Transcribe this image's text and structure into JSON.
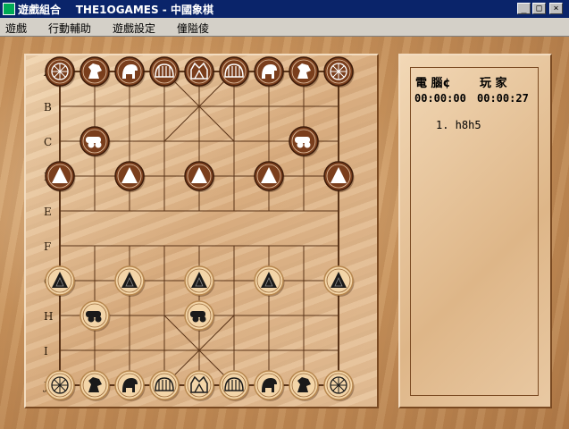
{
  "window": {
    "title": "遊戲組合    THE1OGAMES - 中國象棋",
    "btn_minimize": "_",
    "btn_maximize": "□",
    "btn_close": "×"
  },
  "menu": {
    "items": [
      "遊戲",
      "行動輔助",
      "遊戲設定",
      "僮隘倰"
    ]
  },
  "board": {
    "row_labels": [
      "A",
      "B",
      "C",
      "D",
      "E",
      "F",
      "G",
      "H",
      "I",
      "J"
    ],
    "colors": {
      "line": "#5a3418",
      "dark_piece": "#7a3e1c",
      "light_piece": "#f3d5a8",
      "label": "#2a1a0a"
    },
    "pieces": [
      {
        "side": "dark",
        "kind": "chariot",
        "col": 0,
        "row": 0
      },
      {
        "side": "dark",
        "kind": "horse",
        "col": 1,
        "row": 0
      },
      {
        "side": "dark",
        "kind": "elephant",
        "col": 2,
        "row": 0
      },
      {
        "side": "dark",
        "kind": "advisor",
        "col": 3,
        "row": 0
      },
      {
        "side": "dark",
        "kind": "general",
        "col": 4,
        "row": 0
      },
      {
        "side": "dark",
        "kind": "advisor",
        "col": 5,
        "row": 0
      },
      {
        "side": "dark",
        "kind": "elephant",
        "col": 6,
        "row": 0
      },
      {
        "side": "dark",
        "kind": "horse",
        "col": 7,
        "row": 0
      },
      {
        "side": "dark",
        "kind": "chariot",
        "col": 8,
        "row": 0
      },
      {
        "side": "dark",
        "kind": "cannon",
        "col": 1,
        "row": 2
      },
      {
        "side": "dark",
        "kind": "cannon",
        "col": 7,
        "row": 2
      },
      {
        "side": "dark",
        "kind": "soldier",
        "col": 0,
        "row": 3
      },
      {
        "side": "dark",
        "kind": "soldier",
        "col": 2,
        "row": 3
      },
      {
        "side": "dark",
        "kind": "soldier",
        "col": 4,
        "row": 3
      },
      {
        "side": "dark",
        "kind": "soldier",
        "col": 6,
        "row": 3
      },
      {
        "side": "dark",
        "kind": "soldier",
        "col": 8,
        "row": 3
      },
      {
        "side": "light",
        "kind": "soldier",
        "col": 0,
        "row": 6
      },
      {
        "side": "light",
        "kind": "soldier",
        "col": 2,
        "row": 6
      },
      {
        "side": "light",
        "kind": "soldier",
        "col": 4,
        "row": 6
      },
      {
        "side": "light",
        "kind": "soldier",
        "col": 6,
        "row": 6
      },
      {
        "side": "light",
        "kind": "soldier",
        "col": 8,
        "row": 6
      },
      {
        "side": "light",
        "kind": "cannon",
        "col": 1,
        "row": 7
      },
      {
        "side": "light",
        "kind": "cannon",
        "col": 4,
        "row": 7
      },
      {
        "side": "light",
        "kind": "chariot",
        "col": 0,
        "row": 9
      },
      {
        "side": "light",
        "kind": "horse",
        "col": 1,
        "row": 9
      },
      {
        "side": "light",
        "kind": "elephant",
        "col": 2,
        "row": 9
      },
      {
        "side": "light",
        "kind": "advisor",
        "col": 3,
        "row": 9
      },
      {
        "side": "light",
        "kind": "general",
        "col": 4,
        "row": 9
      },
      {
        "side": "light",
        "kind": "advisor",
        "col": 5,
        "row": 9
      },
      {
        "side": "light",
        "kind": "elephant",
        "col": 6,
        "row": 9
      },
      {
        "side": "light",
        "kind": "horse",
        "col": 7,
        "row": 9
      },
      {
        "side": "light",
        "kind": "chariot",
        "col": 8,
        "row": 9
      }
    ]
  },
  "panel": {
    "player_computer": "電 腦¢",
    "player_human": "玩 家",
    "timer_computer": "00:00:00",
    "timer_human": "00:00:27",
    "moves": [
      "1. h8h5"
    ]
  }
}
